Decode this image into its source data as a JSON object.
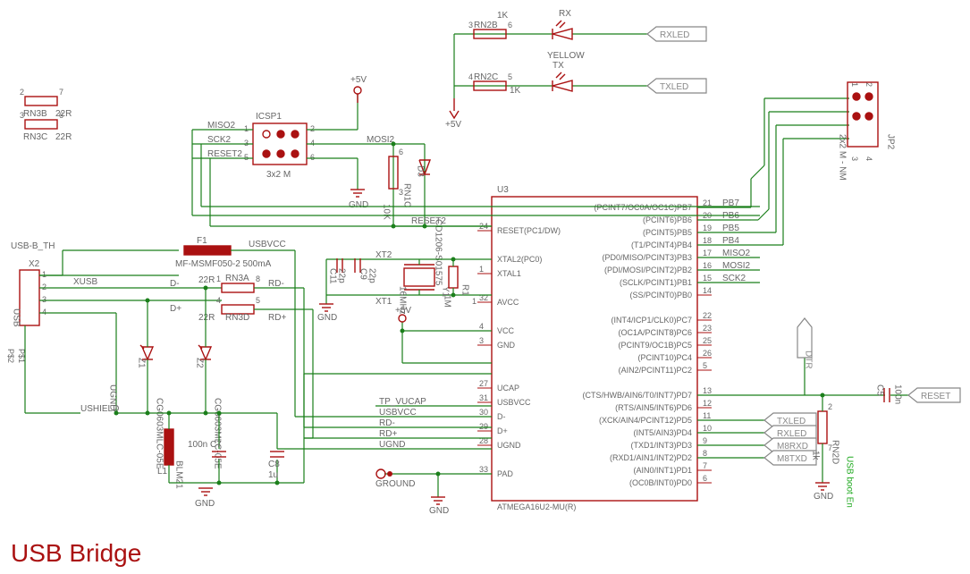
{
  "title": "USB Bridge",
  "ic": {
    "ref": "U3",
    "name": "ATMEGA16U2-MU(R)",
    "pins_left": [
      {
        "num": "24",
        "label": "RESET(PC1/DW)"
      },
      {
        "num": "",
        "label": ""
      },
      {
        "num": "",
        "label": "XTAL2(PC0)"
      },
      {
        "num": "1",
        "label": "XTAL1"
      },
      {
        "num": "",
        "label": ""
      },
      {
        "num": "32",
        "label": "AVCC"
      },
      {
        "num": "",
        "label": ""
      },
      {
        "num": "4",
        "label": "VCC"
      },
      {
        "num": "3",
        "label": "GND"
      },
      {
        "num": "",
        "label": ""
      },
      {
        "num": "",
        "label": ""
      },
      {
        "num": "27",
        "label": "UCAP"
      },
      {
        "num": "31",
        "label": "USBVCC"
      },
      {
        "num": "30",
        "label": "D-"
      },
      {
        "num": "29",
        "label": "D+"
      },
      {
        "num": "28",
        "label": "UGND"
      },
      {
        "num": "",
        "label": ""
      },
      {
        "num": "33",
        "label": "PAD"
      }
    ],
    "pins_right": [
      {
        "num": "21",
        "label": "(PCINT7/OC0A/OC1C)PB7"
      },
      {
        "num": "20",
        "label": "(PCINT6)PB6"
      },
      {
        "num": "19",
        "label": "(PCINT5)PB5"
      },
      {
        "num": "18",
        "label": "(T1/PCINT4)PB4"
      },
      {
        "num": "17",
        "label": "(PD0/MISO/PCINT3)PB3"
      },
      {
        "num": "16",
        "label": "(PDI/MOSI/PCINT2)PB2"
      },
      {
        "num": "15",
        "label": "(SCLK/PCINT1)PB1"
      },
      {
        "num": "14",
        "label": "(SS/PCINT0)PB0"
      },
      {
        "num": "",
        "label": ""
      },
      {
        "num": "22",
        "label": "(INT4/ICP1/CLK0)PC7"
      },
      {
        "num": "23",
        "label": "(OC1A/PCINT8)PC6"
      },
      {
        "num": "25",
        "label": "(PCINT9/OC1B)PC5"
      },
      {
        "num": "26",
        "label": "(PCINT10)PC4"
      },
      {
        "num": "5",
        "label": "(AIN2/PCINT11)PC2"
      },
      {
        "num": "",
        "label": ""
      },
      {
        "num": "13",
        "label": "(CTS/HWB/AIN6/T0/INT7)PD7"
      },
      {
        "num": "12",
        "label": "(RTS/AIN5/INT6)PD6"
      },
      {
        "num": "11",
        "label": "(XCK/AIN4/PCINT12)PD5"
      },
      {
        "num": "10",
        "label": "(INT5/AIN3)PD4"
      },
      {
        "num": "9",
        "label": "(TXD1/INT3)PD3"
      },
      {
        "num": "8",
        "label": "(RXD1/AIN1/INT2)PD2"
      },
      {
        "num": "7",
        "label": "(AIN0/INT1)PD1"
      },
      {
        "num": "6",
        "label": "(OC0B/INT0)PD0"
      }
    ]
  },
  "nets": {
    "plus5v_top": "+5V",
    "plus5v_mid": "+5V",
    "plus5v_bot": "+5V",
    "gnd": "GND",
    "xusb": "XUSB",
    "ugnd": "UGND",
    "ushield": "USHIELD",
    "dminus": "D-",
    "dplus": "D+",
    "rdminus": "RD-",
    "rdplus": "RD+",
    "usbvcc": "USBVCC",
    "tpvucap": "TP_VUCAP",
    "miso2": "MISO2",
    "sck2": "SCK2",
    "reset2": "RESET2",
    "mosi2": "MOSI2",
    "pb7": "PB7",
    "pb6": "PB6",
    "pb5": "PB5",
    "pb4": "PB4",
    "txled": "TXLED",
    "rxled": "RXLED",
    "m8rxd": "M8RXD",
    "m8txd": "M8TXD",
    "dtr": "DTR",
    "reset": "RESET",
    "usbbooten": "USB boot En",
    "xt1": "XT1",
    "xt2": "XT2",
    "ground": "GROUND",
    "rx": "RX",
    "tx": "TX",
    "yellow": "YELLOW"
  },
  "parts": {
    "rn3b": {
      "ref": "RN3B",
      "val": "22R"
    },
    "rn3c": {
      "ref": "RN3C",
      "val": "22R"
    },
    "rn3a": {
      "ref": "RN3A",
      "val": "22R"
    },
    "rn3d": {
      "ref": "RN3D",
      "val": "22R"
    },
    "rn2b": {
      "ref": "RN2B",
      "val": "1K"
    },
    "rn2c": {
      "ref": "RN2C",
      "val": "1K"
    },
    "rn2d": {
      "ref": "RN2D",
      "val": "1k"
    },
    "rn1c": {
      "ref": "RN1C",
      "val": "10K"
    },
    "f1": {
      "ref": "F1",
      "val": "MF-MSMF050-2 500mA"
    },
    "x2": {
      "ref": "X2",
      "val": "USB-B_TH"
    },
    "l1": {
      "ref": "L1",
      "val": "BLM21"
    },
    "z1": {
      "ref": "Z1",
      "val": "CG0603MLC-05E"
    },
    "z2": {
      "ref": "Z2",
      "val": "CG0603MLC-05E"
    },
    "c7": {
      "ref": "C7",
      "val": "100n"
    },
    "c8": {
      "ref": "C8",
      "val": "1u"
    },
    "c9": {
      "ref": "C9",
      "val": "22p"
    },
    "c11": {
      "ref": "C11",
      "val": "22p"
    },
    "c5": {
      "ref": "C5",
      "val": "100n"
    },
    "y1": {
      "ref": "Y1",
      "val": "16MHz"
    },
    "r1": {
      "ref": "R1",
      "val": "1M"
    },
    "d3": {
      "ref": "D3",
      "val": "CD1206-S01575"
    },
    "icsp1": {
      "ref": "ICSP1",
      "val": "3x2 M"
    },
    "jp2": {
      "ref": "JP2",
      "val": "2x2 M - NM"
    },
    "usb": {
      "val": "USB"
    },
    "ps1": "P$1",
    "ps2": "P$2",
    "pins": {
      "p1": "1",
      "p2": "2",
      "p3": "3",
      "p4": "4",
      "p5": "5",
      "p6": "6",
      "p7": "7",
      "p8": "8"
    }
  }
}
